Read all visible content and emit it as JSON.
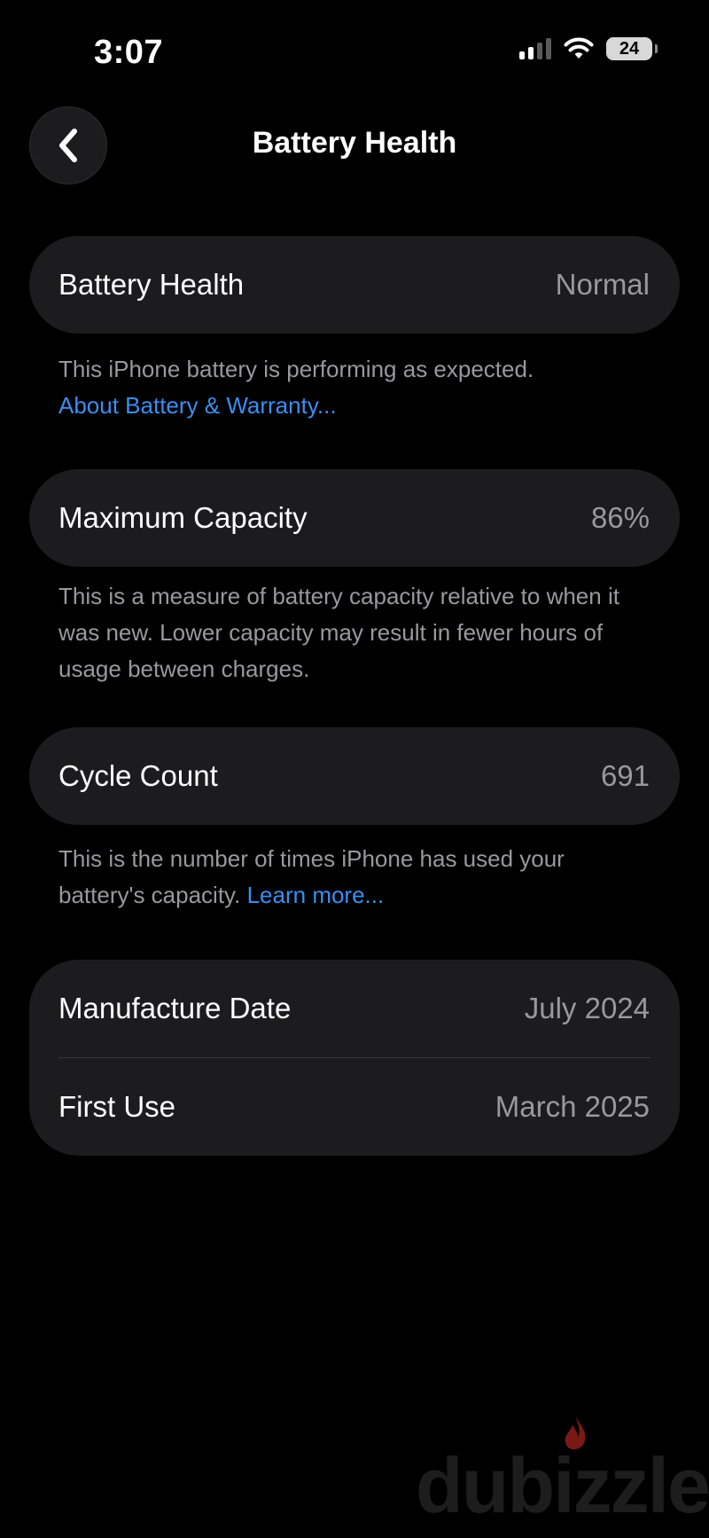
{
  "status_bar": {
    "time": "3:07",
    "battery_level": "24",
    "signal_icon": "cellular-signal-icon",
    "wifi_icon": "wifi-icon"
  },
  "nav": {
    "title": "Battery Health",
    "back_icon": "chevron-left-icon"
  },
  "health": {
    "label": "Battery Health",
    "value": "Normal",
    "note": "This iPhone battery is performing as expected.",
    "link": "About Battery & Warranty..."
  },
  "capacity": {
    "label": "Maximum Capacity",
    "value": "86%",
    "note": "This is a measure of battery capacity relative to when it was new. Lower capacity may result in fewer hours of usage between charges."
  },
  "cycles": {
    "label": "Cycle Count",
    "value": "691",
    "note": "This is the number of times iPhone has used your battery's capacity.",
    "link": "Learn more..."
  },
  "dates": {
    "manufacture_label": "Manufacture Date",
    "manufacture_value": "July 2024",
    "first_use_label": "First Use",
    "first_use_value": "March 2025"
  },
  "watermark": {
    "text": "dubizzle"
  },
  "colors": {
    "background": "#000000",
    "card": "#1c1c1e",
    "secondary_text": "#98989f",
    "link": "#3a8ef0"
  }
}
